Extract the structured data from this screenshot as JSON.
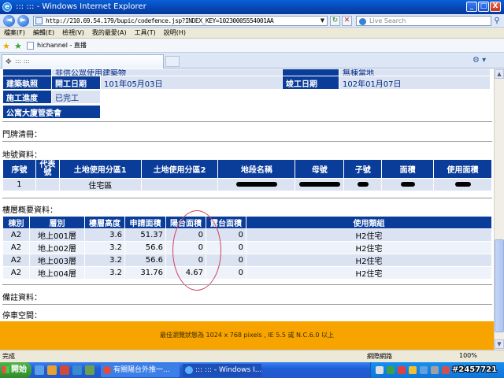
{
  "window": {
    "title": "::: ::: - Windows Internet Explorer",
    "minimize": "_",
    "maximize": "□",
    "close": "X"
  },
  "address": {
    "url": "http://210.69.54.179/bupic/codefence.jsp?INDEX_KEY=10230005554001AA",
    "search_placeholder": "Live Search"
  },
  "menu": [
    "檔案(F)",
    "編輯(E)",
    "檢視(V)",
    "我的最愛(A)",
    "工具(T)",
    "說明(H)"
  ],
  "favorites": {
    "item": "hichannel - 直播"
  },
  "tab": {
    "label": "::: :::"
  },
  "building_info": {
    "top_partial_left": "非供公眾使用建築物",
    "top_partial_right": "無棟當地",
    "rows": [
      {
        "label": "建築執照",
        "k1": "開工日期",
        "v1": "101年05月03日",
        "k2": "竣工日期",
        "v2": "102年01月07日"
      }
    ],
    "progress_label": "施工進度",
    "progress_value": "已完工",
    "mgmt_label": "公寓大廈管委會"
  },
  "sections": {
    "door": "門牌清冊：",
    "land": "地號資料：",
    "floor": "樓層概要資料：",
    "notes": "備註資料：",
    "parking": "停車空間："
  },
  "land_table": {
    "headers": [
      "序號",
      "代表號",
      "土地使用分區1",
      "土地使用分區2",
      "地段名稱",
      "母號",
      "子號",
      "面積",
      "使用面積"
    ],
    "rows": [
      {
        "no": "1",
        "rep": "",
        "zone1": "住宅區",
        "zone2": ""
      }
    ]
  },
  "floor_table": {
    "headers": [
      "棟別",
      "層別",
      "樓層高度",
      "申請面積",
      "陽台面積",
      "露台面積",
      "使用類組"
    ],
    "rows": [
      {
        "bldg": "A2",
        "floor": "地上001層",
        "height": "3.6",
        "area": "51.37",
        "balcony": "0",
        "terrace": "0",
        "use": "H2住宅"
      },
      {
        "bldg": "A2",
        "floor": "地上002層",
        "height": "3.2",
        "area": "56.6",
        "balcony": "0",
        "terrace": "0",
        "use": "H2住宅"
      },
      {
        "bldg": "A2",
        "floor": "地上003層",
        "height": "3.2",
        "area": "56.6",
        "balcony": "0",
        "terrace": "0",
        "use": "H2住宅"
      },
      {
        "bldg": "A2",
        "floor": "地上004層",
        "height": "3.2",
        "area": "31.76",
        "balcony": "4.67",
        "terrace": "0",
        "use": "H2住宅"
      }
    ]
  },
  "footer": {
    "text": "最佳瀏覽狀態為 1024 x 768 pixels , IE 5.5 或 N.C.6.0 以上"
  },
  "status": {
    "left": "完成",
    "zone": "網際網路",
    "zoom": "100%"
  },
  "taskbar": {
    "start": "開始",
    "tasks": [
      "有關陽台外推一...",
      "::: ::: - Windows I..."
    ]
  },
  "watermark": "#2457721",
  "colors": {
    "header_blue": "#0a3c9a",
    "row_light": "#dbe3f3",
    "footer_orange": "#f7a400",
    "circle": "#d04060"
  }
}
